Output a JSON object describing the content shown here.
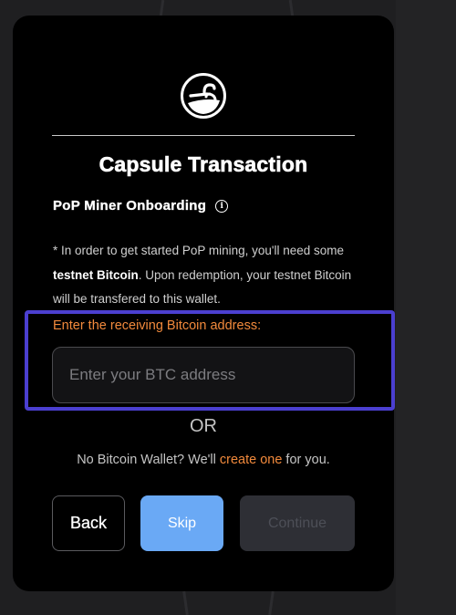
{
  "dialog": {
    "title": "Capsule Transaction",
    "subtitle": "PoP Miner Onboarding",
    "info_icon": "info-icon",
    "logo_icon": "capsule-logo-icon",
    "note": {
      "prefix": "* In order to get started PoP mining, you'll need some ",
      "bold": "testnet Bitcoin",
      "suffix": ". Upon redemption, your testnet Bitcoin will be transfered to this wallet."
    },
    "input_label": "Enter the receiving Bitcoin address:",
    "input_placeholder": "Enter your BTC address",
    "input_value": "",
    "or_text": "OR",
    "create": {
      "prefix": "No Bitcoin Wallet? We'll ",
      "link": "create one",
      "suffix": " for you."
    }
  },
  "buttons": {
    "back": "Back",
    "skip": "Skip",
    "continue": "Continue"
  },
  "colors": {
    "accent_orange": "#f28a3c",
    "skip_blue": "#6aa9f5",
    "highlight_border": "#4b3fd0",
    "disabled_bg": "#2e2f35"
  }
}
